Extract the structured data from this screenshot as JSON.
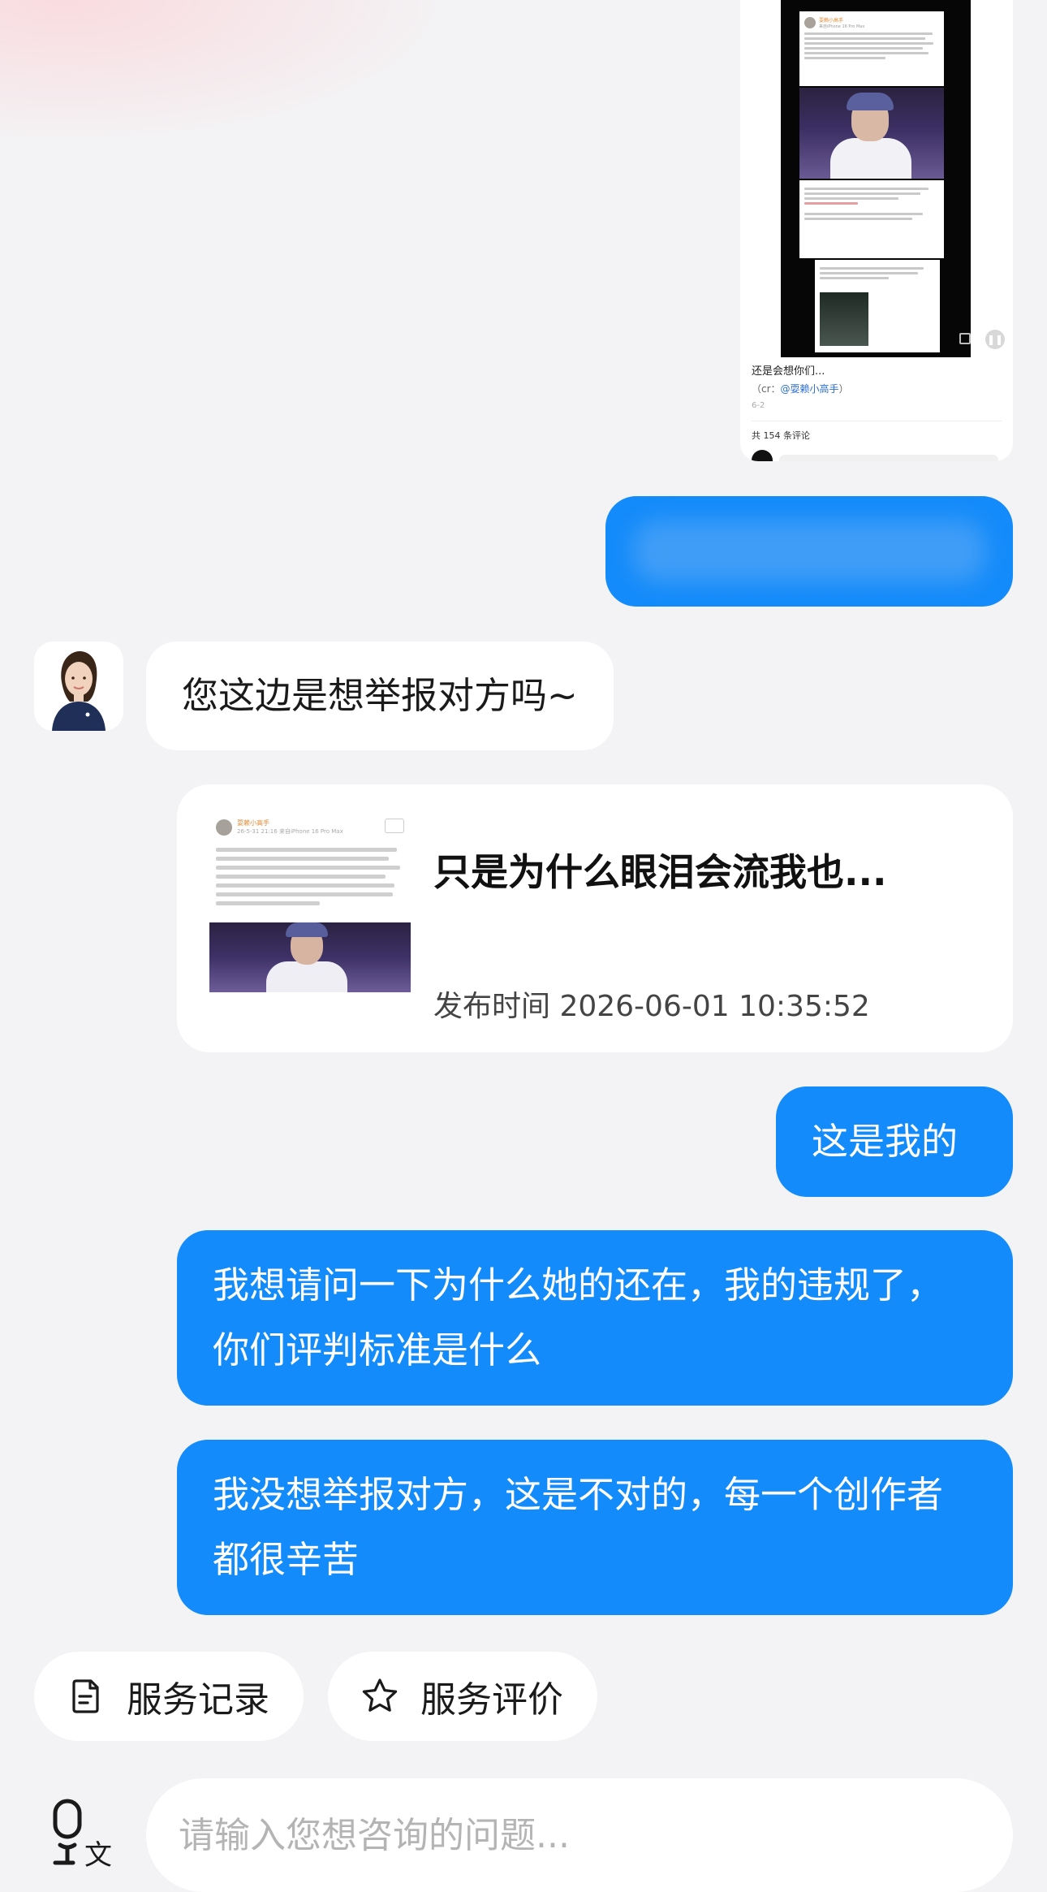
{
  "shared_screenshot": {
    "post_author": "耍赖小高手",
    "post_device": "来自iPhone 16 Pro Max",
    "caption": "还是会想你们...",
    "credit_prefix": "（cr：",
    "credit_mention": "@耍赖小高手",
    "credit_suffix": "）",
    "date": "6-2",
    "comment_count": "共 154 条评论"
  },
  "messages": {
    "agent_question": "您这边是想举报对方吗~",
    "mine_1": "这是我的",
    "mine_2": "我想请问一下为什么她的还在，我的违规了，你们评判标准是什么",
    "mine_3": "我没想举报对方，这是不对的，每一个创作者都很辛苦"
  },
  "link_card": {
    "title": "只是为什么眼泪会流我也...",
    "time_label": "发布时间 2026-06-01 10:35:52",
    "thumb_author": "耍赖小高手",
    "thumb_sub": "26-5-31 21:16 来自iPhone 16 Pro Max"
  },
  "quick_actions": {
    "service_record": "服务记录",
    "service_rating": "服务评价"
  },
  "input": {
    "placeholder": "请输入您想咨询的问题..."
  },
  "icons": {
    "voice": "mic-translate-icon",
    "record": "document-icon",
    "rating": "star-outline-icon",
    "play": "pause-icon",
    "fullscreen": "fullscreen-icon"
  },
  "colors": {
    "user_bubble": "#138bfa",
    "agent_bubble": "#ffffff",
    "background": "#f3f3f5"
  }
}
